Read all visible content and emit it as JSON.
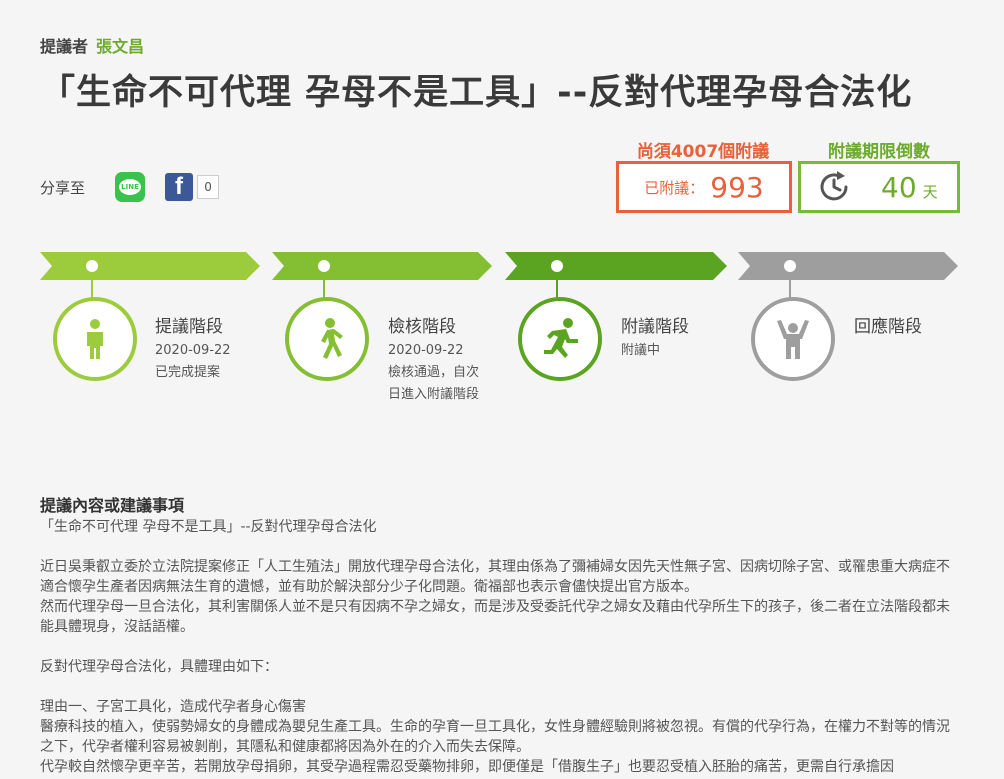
{
  "proposer": {
    "label": "提議者",
    "name": "張文昌"
  },
  "title": "「生命不可代理 孕母不是工具」--反對代理孕母合法化",
  "share": {
    "label": "分享至",
    "line_text": "LINE",
    "fb_text": "f",
    "fb_count": "0"
  },
  "stats": {
    "need_text": "尚須4007個附議",
    "signed_label": "已附議：",
    "signed_count": "993",
    "deadline_title": "附議期限倒數",
    "days": "40",
    "days_unit": "天"
  },
  "steps": [
    {
      "title": "提議階段",
      "line1": "2020-09-22",
      "line2": "已完成提案",
      "line3": "",
      "icon": "standing-person-icon",
      "color": "#9ccc3c"
    },
    {
      "title": "檢核階段",
      "line1": "2020-09-22",
      "line2": "檢核通過，自次",
      "line3": "日進入附議階段",
      "icon": "walking-person-icon",
      "color": "#84bf33"
    },
    {
      "title": "附議階段",
      "line1": "附議中",
      "line2": "",
      "line3": "",
      "icon": "running-person-icon",
      "color": "#5ba421"
    },
    {
      "title": "回應階段",
      "line1": "",
      "line2": "",
      "line3": "",
      "icon": "cheering-person-icon",
      "color": "#9e9e9e"
    }
  ],
  "content": {
    "heading": "提議內容或建議事項",
    "subtitle": "「生命不可代理 孕母不是工具」--反對代理孕母合法化",
    "para1": "近日吳秉叡立委於立法院提案修正「人工生殖法」開放代理孕母合法化，其理由係為了彌補婦女因先天性無子宮、因病切除子宮、或罹患重大病症不適合懷孕生產者因病無法生育的遺憾，並有助於解決部分少子化問題。衛福部也表示會儘快提出官方版本。",
    "para2": "然而代理孕母一旦合法化，其利害關係人並不是只有因病不孕之婦女，而是涉及受委託代孕之婦女及藉由代孕所生下的孩子，後二者在立法階段都未能具體現身，沒話語權。",
    "para3": "反對代理孕母合法化，具體理由如下：",
    "reason1_title": "理由一、子宮工具化，造成代孕者身心傷害",
    "reason1_p1": "醫療科技的植入，使弱勢婦女的身體成為嬰兒生產工具。生命的孕育一旦工具化，女性身體經驗則將被忽視。有償的代孕行為，在權力不對等的情況之下，代孕者權利容易被剝削，其隱私和健康都將因為外在的介入而失去保障。",
    "reason1_p2": "代孕較自然懷孕更辛苦，若開放孕母捐卵，其受孕過程需忍受藥物排卵，即便僅是「借腹生子」也要忍受植入胚胎的痛苦，更需自行承擔因"
  }
}
